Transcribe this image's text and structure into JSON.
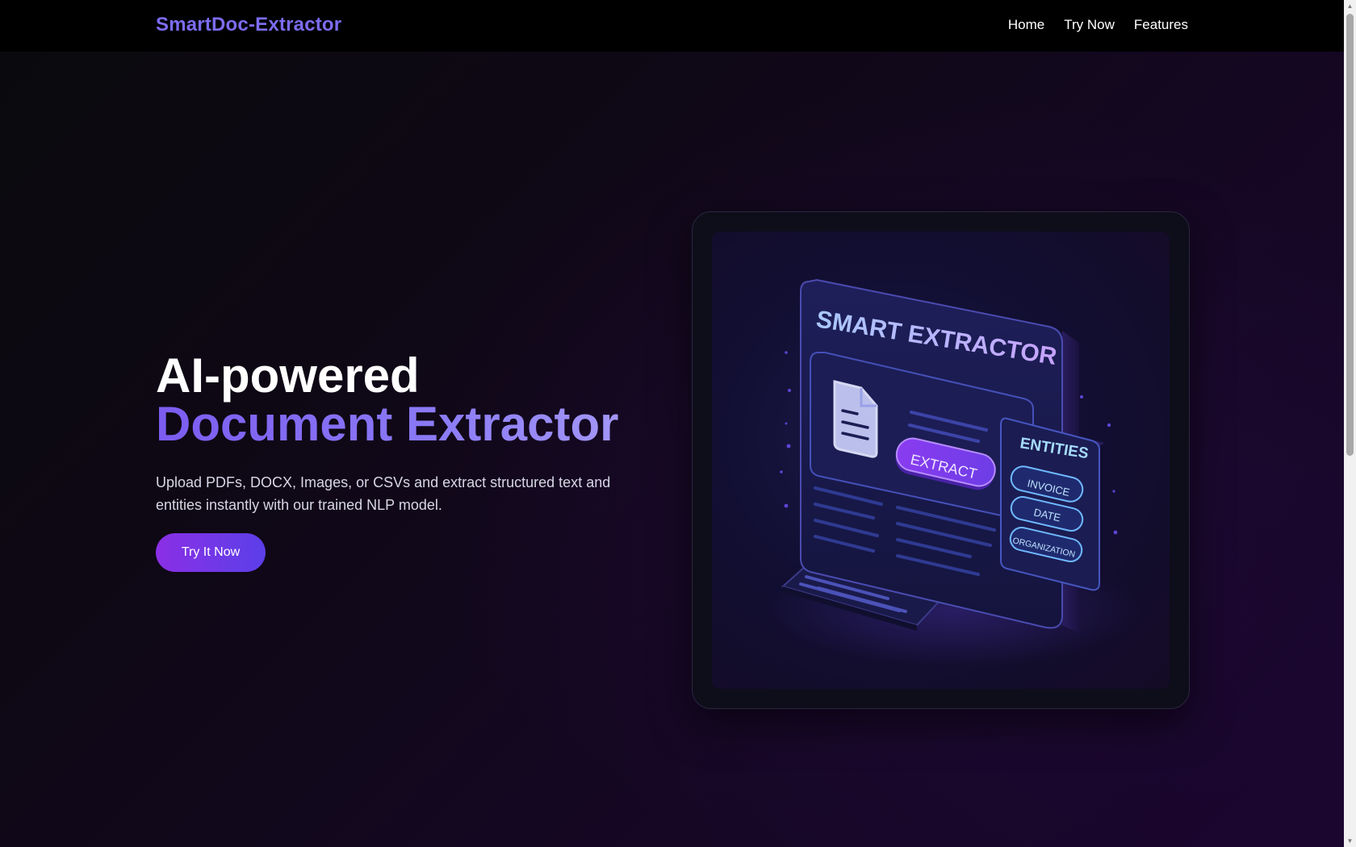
{
  "nav": {
    "brand": "SmartDoc-Extractor",
    "links": [
      "Home",
      "Try Now",
      "Features"
    ]
  },
  "hero": {
    "title_line1": "AI-powered",
    "title_line2": "Document Extractor",
    "subtitle": "Upload PDFs, DOCX, Images, or CSVs and extract structured text and entities instantly with our trained NLP model.",
    "cta_label": "Try It Now"
  },
  "illustration": {
    "heading": "SMART EXTRACTOR",
    "button_label": "EXTRACT",
    "entities_title": "ENTITIES",
    "entities": [
      "INVOICE",
      "DATE",
      "ORGANIZATION"
    ]
  },
  "colors": {
    "accent": "#7c6cf0",
    "cta_start": "#8b2fe6",
    "cta_end": "#5b3fe8",
    "nav_bg": "#000000"
  }
}
